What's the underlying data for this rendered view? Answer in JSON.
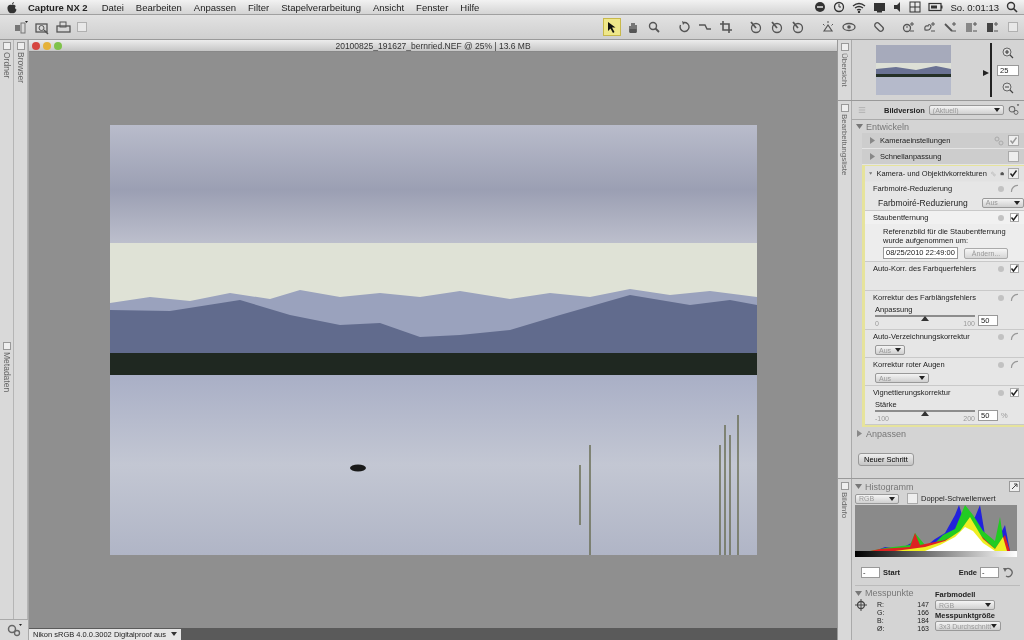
{
  "menubar": {
    "app_name": "Capture NX 2",
    "menus": [
      "Datei",
      "Bearbeiten",
      "Anpassen",
      "Filter",
      "Stapelverarbeitung",
      "Ansicht",
      "Fenster",
      "Hilfe"
    ],
    "clock": "So. 0:01:13"
  },
  "toolbar": {
    "tools": [
      {
        "kind": "arrow",
        "selected": true
      },
      {
        "kind": "hand",
        "selected": false
      },
      {
        "kind": "zoom",
        "selected": false
      },
      {
        "kind": "rotate",
        "selected": false
      },
      {
        "kind": "straighten",
        "selected": false
      },
      {
        "kind": "crop",
        "selected": false
      },
      {
        "kind": "pen",
        "selected": false
      },
      {
        "kind": "pen",
        "selected": false
      },
      {
        "kind": "pen",
        "selected": false
      },
      {
        "kind": "sun",
        "selected": false
      },
      {
        "kind": "eye",
        "selected": false
      },
      {
        "kind": "bandage",
        "selected": false
      },
      {
        "kind": "control-point",
        "selected": false
      },
      {
        "kind": "lasso",
        "selected": false
      },
      {
        "kind": "line",
        "selected": false
      },
      {
        "kind": "gradient",
        "selected": false
      },
      {
        "kind": "fill",
        "selected": false
      }
    ]
  },
  "left_strip": {
    "tabs": [
      "Ordner",
      "Metadaten"
    ],
    "inner_tabs": [
      "Browser"
    ]
  },
  "document": {
    "title": "20100825_191627_bernried.NEF @ 25% | 13.6 MB",
    "status": "Nikon sRGB 4.0.0.3002 Digitalproof aus"
  },
  "overview": {
    "tab": "Übersicht",
    "zoom": "25",
    "level": 0.45
  },
  "edit_list": {
    "tab": "Bearbeitungsliste",
    "version_label": "Bildversion",
    "version": "(Aktuell)",
    "section": "Entwickeln",
    "steps": [
      {
        "label": "Kameraeinstellungen",
        "expanded": false,
        "checked": true,
        "linked": true
      },
      {
        "label": "Schnellanpassung",
        "expanded": false,
        "checked": false,
        "linked": false
      },
      {
        "label": "Kamera- und Objektivkorrekturen",
        "expanded": true,
        "checked": true,
        "linked": true,
        "items": [
          {
            "kind": "labeled-dropdown",
            "label": "Farbmoiré-Reduzierung",
            "checked": false,
            "field_label": "Farbmoiré-Reduzierung",
            "value": "Aus"
          },
          {
            "kind": "dust",
            "label": "Staubentfernung",
            "checked": true,
            "note": "Referenzbild für die Staubentfernung wurde aufgenommen um:",
            "date": "08/25/2010 22:49:00",
            "button": "Ändern..."
          },
          {
            "kind": "plain",
            "label": "Auto-Korr. des Farbquerfehlers",
            "checked": true
          },
          {
            "kind": "slider",
            "label": "Korrektur des Farblängsfehlers",
            "checked": false,
            "slider_label": "Anpassung",
            "min": "0",
            "max": "100",
            "value": "50",
            "level": 0.5
          },
          {
            "kind": "dropdown",
            "label": "Auto-Verzeichnungskorrektur",
            "checked": false,
            "value": "Aus"
          },
          {
            "kind": "dropdown",
            "label": "Korrektur roter Augen",
            "checked": false,
            "value": "Aus"
          },
          {
            "kind": "slider",
            "label": "Vignettierungskorrektur",
            "checked": true,
            "slider_label": "Stärke",
            "min": "-100",
            "max": "200",
            "value": "50",
            "unit": "%",
            "level": 0.5
          }
        ]
      }
    ],
    "collapsed_section": "Anpassen",
    "new_step_button": "Neuer Schritt"
  },
  "info": {
    "tab": "Bildinfo",
    "histogram": {
      "title": "Histogramm",
      "channel": "RGB",
      "double_threshold": {
        "label": "Doppel-Schwellenwert",
        "checked": false
      },
      "start_label": "Start",
      "start": "-",
      "end_label": "Ende",
      "end": "-"
    },
    "sample_points": {
      "title": "Messpunkte",
      "rows": [
        {
          "label": "R:",
          "value": "147"
        },
        {
          "label": "G:",
          "value": "166"
        },
        {
          "label": "B:",
          "value": "184"
        },
        {
          "label": "Ø:",
          "value": "163"
        }
      ],
      "color_model_label": "Farbmodell",
      "color_model": "RGB",
      "size_label": "Messpunktgröße",
      "size": "3x3 Durchschnitt"
    }
  }
}
